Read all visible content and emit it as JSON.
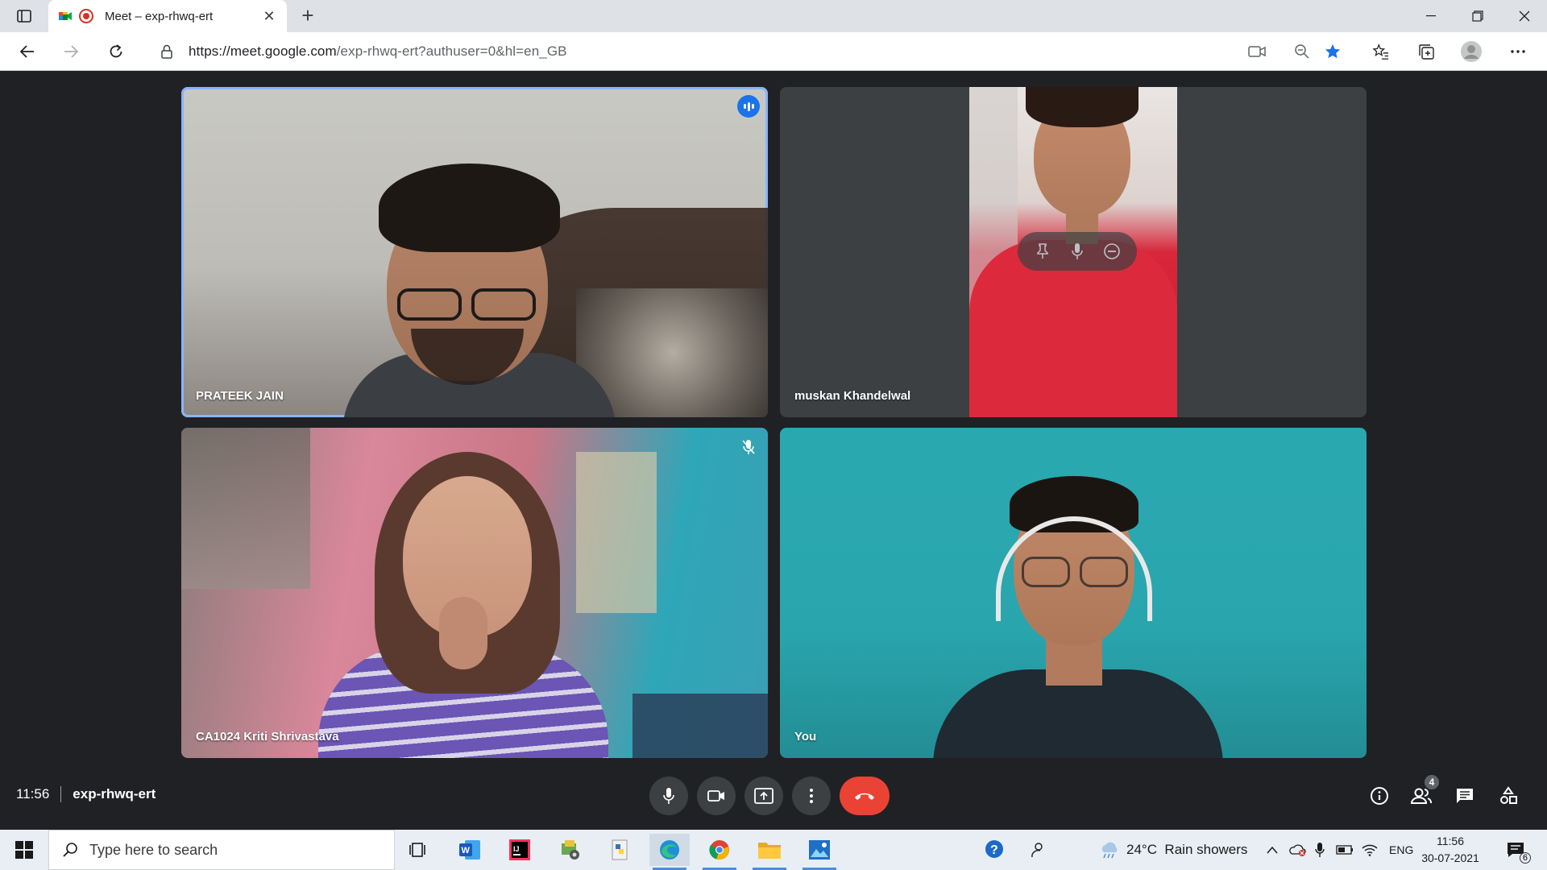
{
  "browser": {
    "tab_title": "Meet – exp-rhwq-ert",
    "url_host": "https://meet.google.com",
    "url_path": "/exp-rhwq-ert?authuser=0&hl=en_GB"
  },
  "participants": [
    {
      "name": "PRATEEK JAIN",
      "speaking": true
    },
    {
      "name": "muskan Khandelwal"
    },
    {
      "name": "CA1024 Kriti Shrivastava",
      "muted": true
    },
    {
      "name": "You"
    }
  ],
  "meeting": {
    "time": "11:56",
    "code": "exp-rhwq-ert",
    "participant_count": "4"
  },
  "taskbar": {
    "search_placeholder": "Type here to search",
    "weather": "24°C  Rain showers",
    "language": "ENG",
    "time": "11:56",
    "date": "30-07-2021",
    "notification_count": "6"
  },
  "colors": {
    "end_call": "#ea4335",
    "active_border": "#8ab4f8",
    "speaking_badge": "#1a73e8"
  }
}
